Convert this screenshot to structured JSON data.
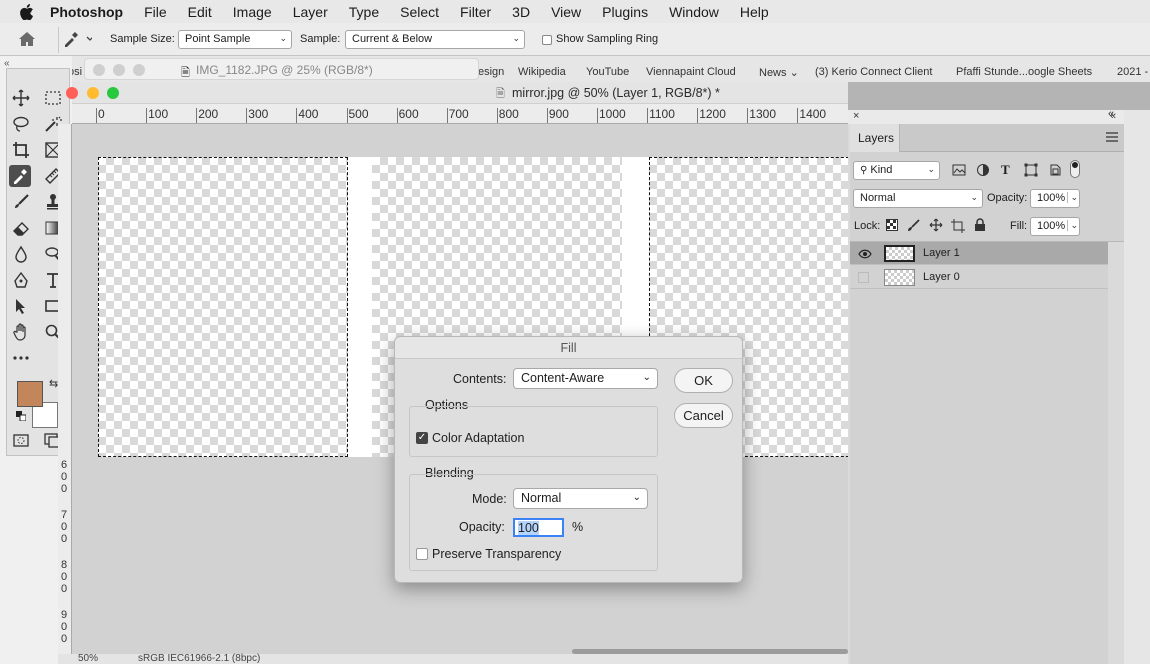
{
  "menubar": {
    "app": "Photoshop",
    "items": [
      "File",
      "Edit",
      "Image",
      "Layer",
      "Type",
      "Select",
      "Filter",
      "3D",
      "View",
      "Plugins",
      "Window",
      "Help"
    ]
  },
  "options_bar": {
    "sample_size_label": "Sample Size:",
    "sample_size_value": "Point Sample",
    "sample_label": "Sample:",
    "sample_value": "Current & Below",
    "show_ring_label": "Show Sampling Ring"
  },
  "browser": {
    "ghost_tab": "IMG_1182.JPG @ 25% (RGB/8*)",
    "bookmarks": [
      "osi",
      "esign",
      "Wikipedia",
      "YouTube",
      "Viennapaint Cloud",
      "News",
      "(3) Kerio Connect Client",
      "Pfaffi Stunde...oogle Sheets",
      "2021 -"
    ]
  },
  "document": {
    "title": "mirror.jpg @ 50% (Layer 1, RGB/8*) *",
    "ruler_h": [
      "0",
      "100",
      "200",
      "300",
      "400",
      "500",
      "600",
      "700",
      "800",
      "900",
      "1000",
      "1100",
      "1200",
      "1300",
      "1400"
    ],
    "ruler_v": [
      [
        "6",
        "0",
        "0"
      ],
      [
        "7",
        "0",
        "0"
      ],
      [
        "8",
        "0",
        "0"
      ],
      [
        "9",
        "0",
        "0"
      ]
    ],
    "zoom": "50%",
    "profile": "sRGB IEC61966-2.1 (8bpc)"
  },
  "layers_panel": {
    "tab": "Layers",
    "filter_kind": "Kind",
    "blend_mode": "Normal",
    "opacity_label": "Opacity:",
    "opacity_value": "100%",
    "lock_label": "Lock:",
    "fill_label": "Fill:",
    "fill_value": "100%",
    "layers": [
      {
        "name": "Layer 1",
        "visible": true,
        "selected": true
      },
      {
        "name": "Layer 0",
        "visible": false,
        "selected": false
      }
    ]
  },
  "fill_dialog": {
    "title": "Fill",
    "contents_label": "Contents:",
    "contents_value": "Content-Aware",
    "options_label": "Options",
    "color_adaptation_label": "Color Adaptation",
    "color_adaptation_checked": true,
    "blending_label": "Blending",
    "mode_label": "Mode:",
    "mode_value": "Normal",
    "opacity_label": "Opacity:",
    "opacity_value": "100",
    "opacity_unit": "%",
    "preserve_label": "Preserve Transparency",
    "preserve_checked": false,
    "ok_label": "OK",
    "cancel_label": "Cancel"
  },
  "colors": {
    "foreground": "#c2865a",
    "background": "#ffffff",
    "focus": "#3b82f6"
  }
}
